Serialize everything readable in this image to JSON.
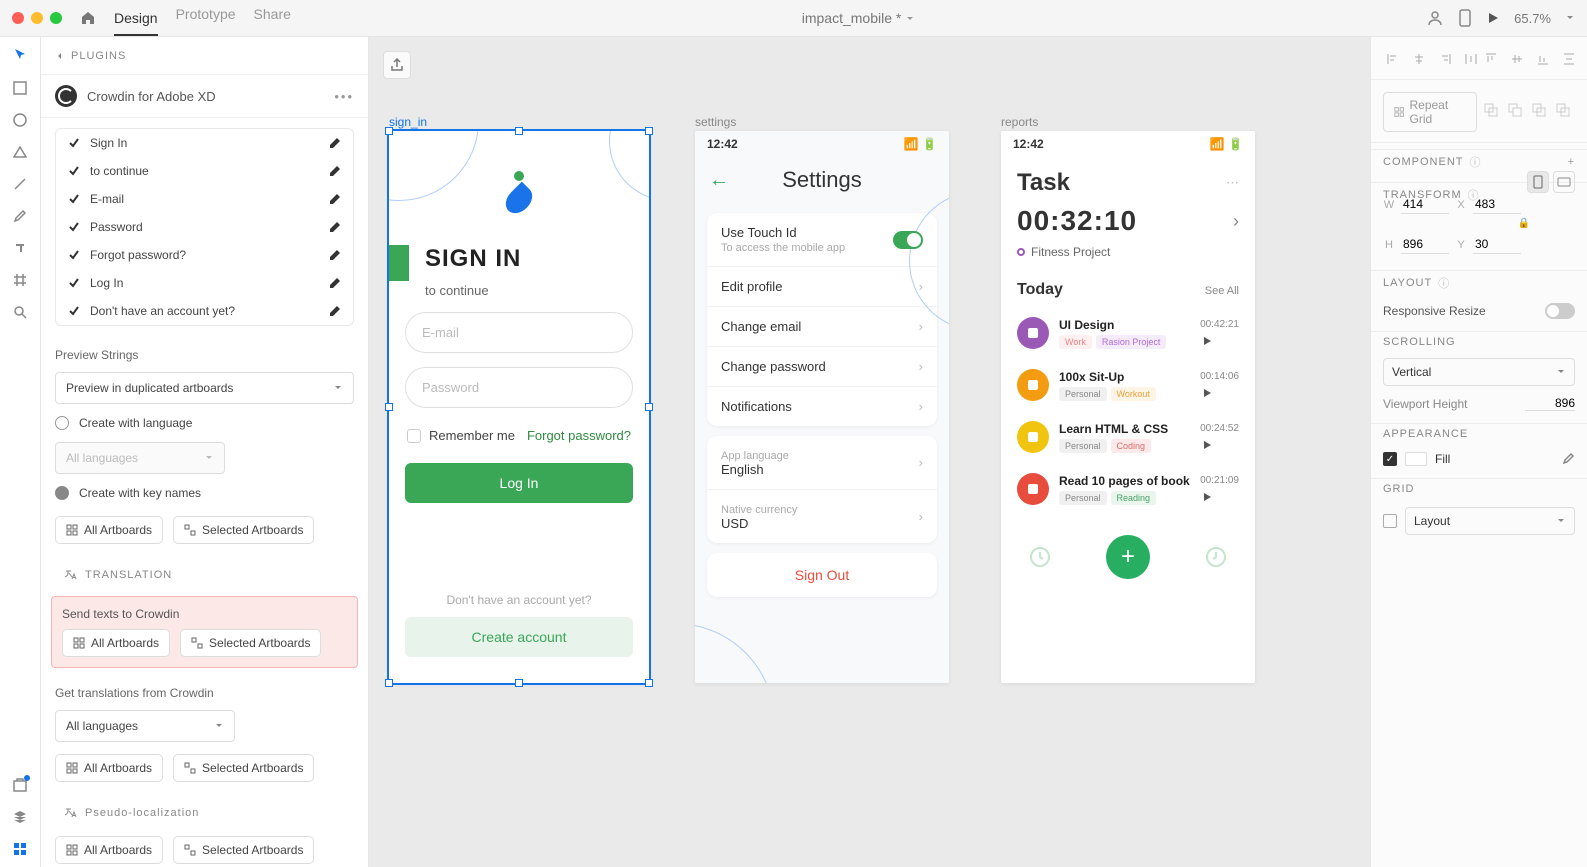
{
  "topbar": {
    "tabs": [
      "Design",
      "Prototype",
      "Share"
    ],
    "doctitle": "impact_mobile *",
    "zoom": "65.7%"
  },
  "leftpanel": {
    "plugins_label": "PLUGINS",
    "plugin_name": "Crowdin for Adobe XD",
    "strings": [
      "Sign In",
      "to continue",
      "E-mail",
      "Password",
      "Forgot password?",
      "Log In",
      "Don't have an account yet?"
    ],
    "preview_label": "Preview Strings",
    "preview_select": "Preview in duplicated artboards",
    "create_lang": "Create with language",
    "all_lang": "All languages",
    "create_keys": "Create with key names",
    "all_artboards": "All Artboards",
    "sel_artboards": "Selected Artboards",
    "translation_hdr": "TRANSLATION",
    "send_label": "Send texts to Crowdin",
    "get_label": "Get translations from Crowdin",
    "pseudo_hdr": "Pseudo-localization"
  },
  "artboards": {
    "sign_in": {
      "label": "sign_in",
      "title": "SIGN IN",
      "subtitle": "to continue",
      "email_ph": "E-mail",
      "pw_ph": "Password",
      "remember": "Remember me",
      "forgot": "Forgot password?",
      "login": "Log In",
      "noacct": "Don't have an account yet?",
      "create": "Create account"
    },
    "settings": {
      "label": "settings",
      "time": "12:42",
      "title": "Settings",
      "touchid": "Use Touch Id",
      "touchid_sub": "To access the mobile app",
      "rows": [
        "Edit profile",
        "Change email",
        "Change password",
        "Notifications"
      ],
      "applang_lbl": "App language",
      "applang_val": "English",
      "currency_lbl": "Native currency",
      "currency_val": "USD",
      "signout": "Sign Out"
    },
    "reports": {
      "label": "reports",
      "time": "12:42",
      "task_hdr": "Task",
      "timer": "00:32:10",
      "project": "Fitness Project",
      "today": "Today",
      "seeall": "See All",
      "tasks": [
        {
          "name": "UI Design",
          "tags": [
            {
              "t": "Work",
              "c": "#f08383",
              "bg": "#fef0f0"
            },
            {
              "t": "Rasion Project",
              "c": "#b06ad4",
              "bg": "#f5ecfb"
            }
          ],
          "time": "00:42:21",
          "color": "#9b59b6"
        },
        {
          "name": "100x Sit-Up",
          "tags": [
            {
              "t": "Personal",
              "c": "#888",
              "bg": "#f0f0f0"
            },
            {
              "t": "Workout",
              "c": "#e8a33d",
              "bg": "#fdf4e5"
            }
          ],
          "time": "00:14:06",
          "color": "#f39c12"
        },
        {
          "name": "Learn HTML & CSS",
          "tags": [
            {
              "t": "Personal",
              "c": "#888",
              "bg": "#f0f0f0"
            },
            {
              "t": "Coding",
              "c": "#e06b6b",
              "bg": "#fceaea"
            }
          ],
          "time": "00:24:52",
          "color": "#f1c40f"
        },
        {
          "name": "Read 10 pages of book",
          "tags": [
            {
              "t": "Personal",
              "c": "#888",
              "bg": "#f0f0f0"
            },
            {
              "t": "Reading",
              "c": "#4aa366",
              "bg": "#e9f5ed"
            }
          ],
          "time": "00:21:09",
          "color": "#e74c3c"
        }
      ]
    }
  },
  "rightpanel": {
    "repeat": "Repeat Grid",
    "component": "COMPONENT",
    "transform": "TRANSFORM",
    "w": "414",
    "x": "483",
    "h": "896",
    "y": "30",
    "layout": "LAYOUT",
    "responsive": "Responsive Resize",
    "scrolling": "SCROLLING",
    "scroll_val": "Vertical",
    "vp_lbl": "Viewport Height",
    "vp_val": "896",
    "appearance": "APPEARANCE",
    "fill": "Fill",
    "grid": "GRID",
    "grid_val": "Layout"
  }
}
